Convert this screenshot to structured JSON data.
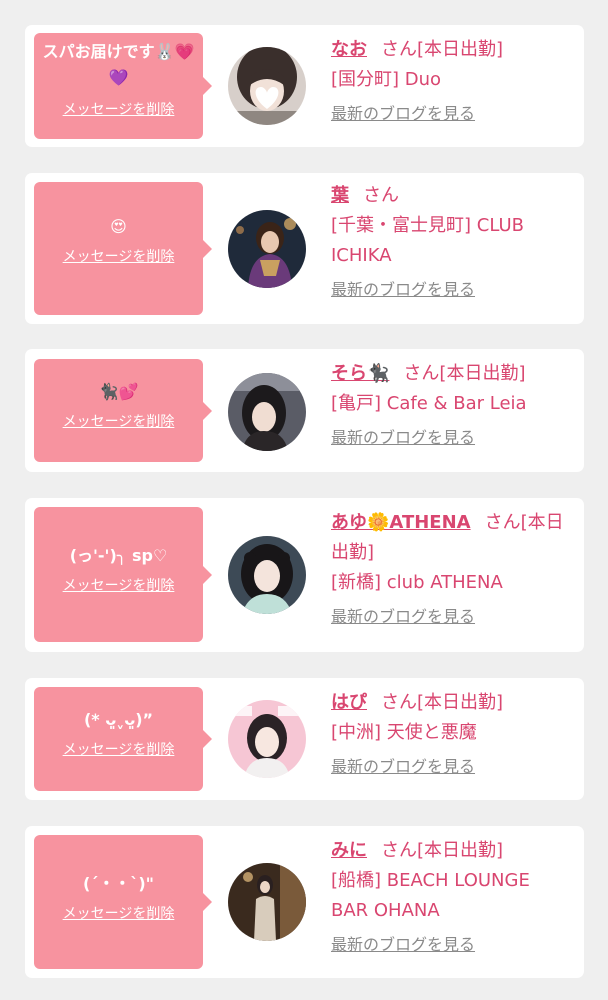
{
  "delete_label": "メッセージを削除",
  "blog_label": "最新のブログを見る",
  "honorific": "さん",
  "colors": {
    "bubble": "#f7939f",
    "name": "#d94670",
    "link_gray": "#8a8a8a",
    "background": "#efefef"
  },
  "items": [
    {
      "message": "スパお届けです🐰💗💜",
      "name": "なお",
      "status": "[本日出勤]",
      "shop": "[国分町] Duo",
      "avatar_icon": "profile-photo"
    },
    {
      "message": "😍",
      "name": "葉",
      "status": "",
      "shop": "[千葉・富士見町] CLUB ICHIKA",
      "avatar_icon": "profile-photo"
    },
    {
      "message": "🐈‍⬛💕",
      "name": "そら🐈‍⬛",
      "status": "[本日出勤]",
      "shop": "[亀戸] Cafe & Bar Leia",
      "avatar_icon": "profile-photo"
    },
    {
      "message": "(っ'-')╮ sp♡",
      "name": "あゆ🌼ATHENA",
      "status": "[本日出勤]",
      "shop": "[新橋] club ATHENA",
      "avatar_icon": "profile-photo"
    },
    {
      "message": "(* ᴗ͈ˬᴗ͈)”",
      "name": "はぴ",
      "status": "[本日出勤]",
      "shop": "[中洲] 天使と悪魔",
      "avatar_icon": "profile-photo"
    },
    {
      "message": "(ˊ・・ˋ)\"",
      "name": "みに",
      "status": "[本日出勤]",
      "shop": "[船橋] BEACH LOUNGE BAR OHANA",
      "avatar_icon": "profile-photo"
    }
  ]
}
